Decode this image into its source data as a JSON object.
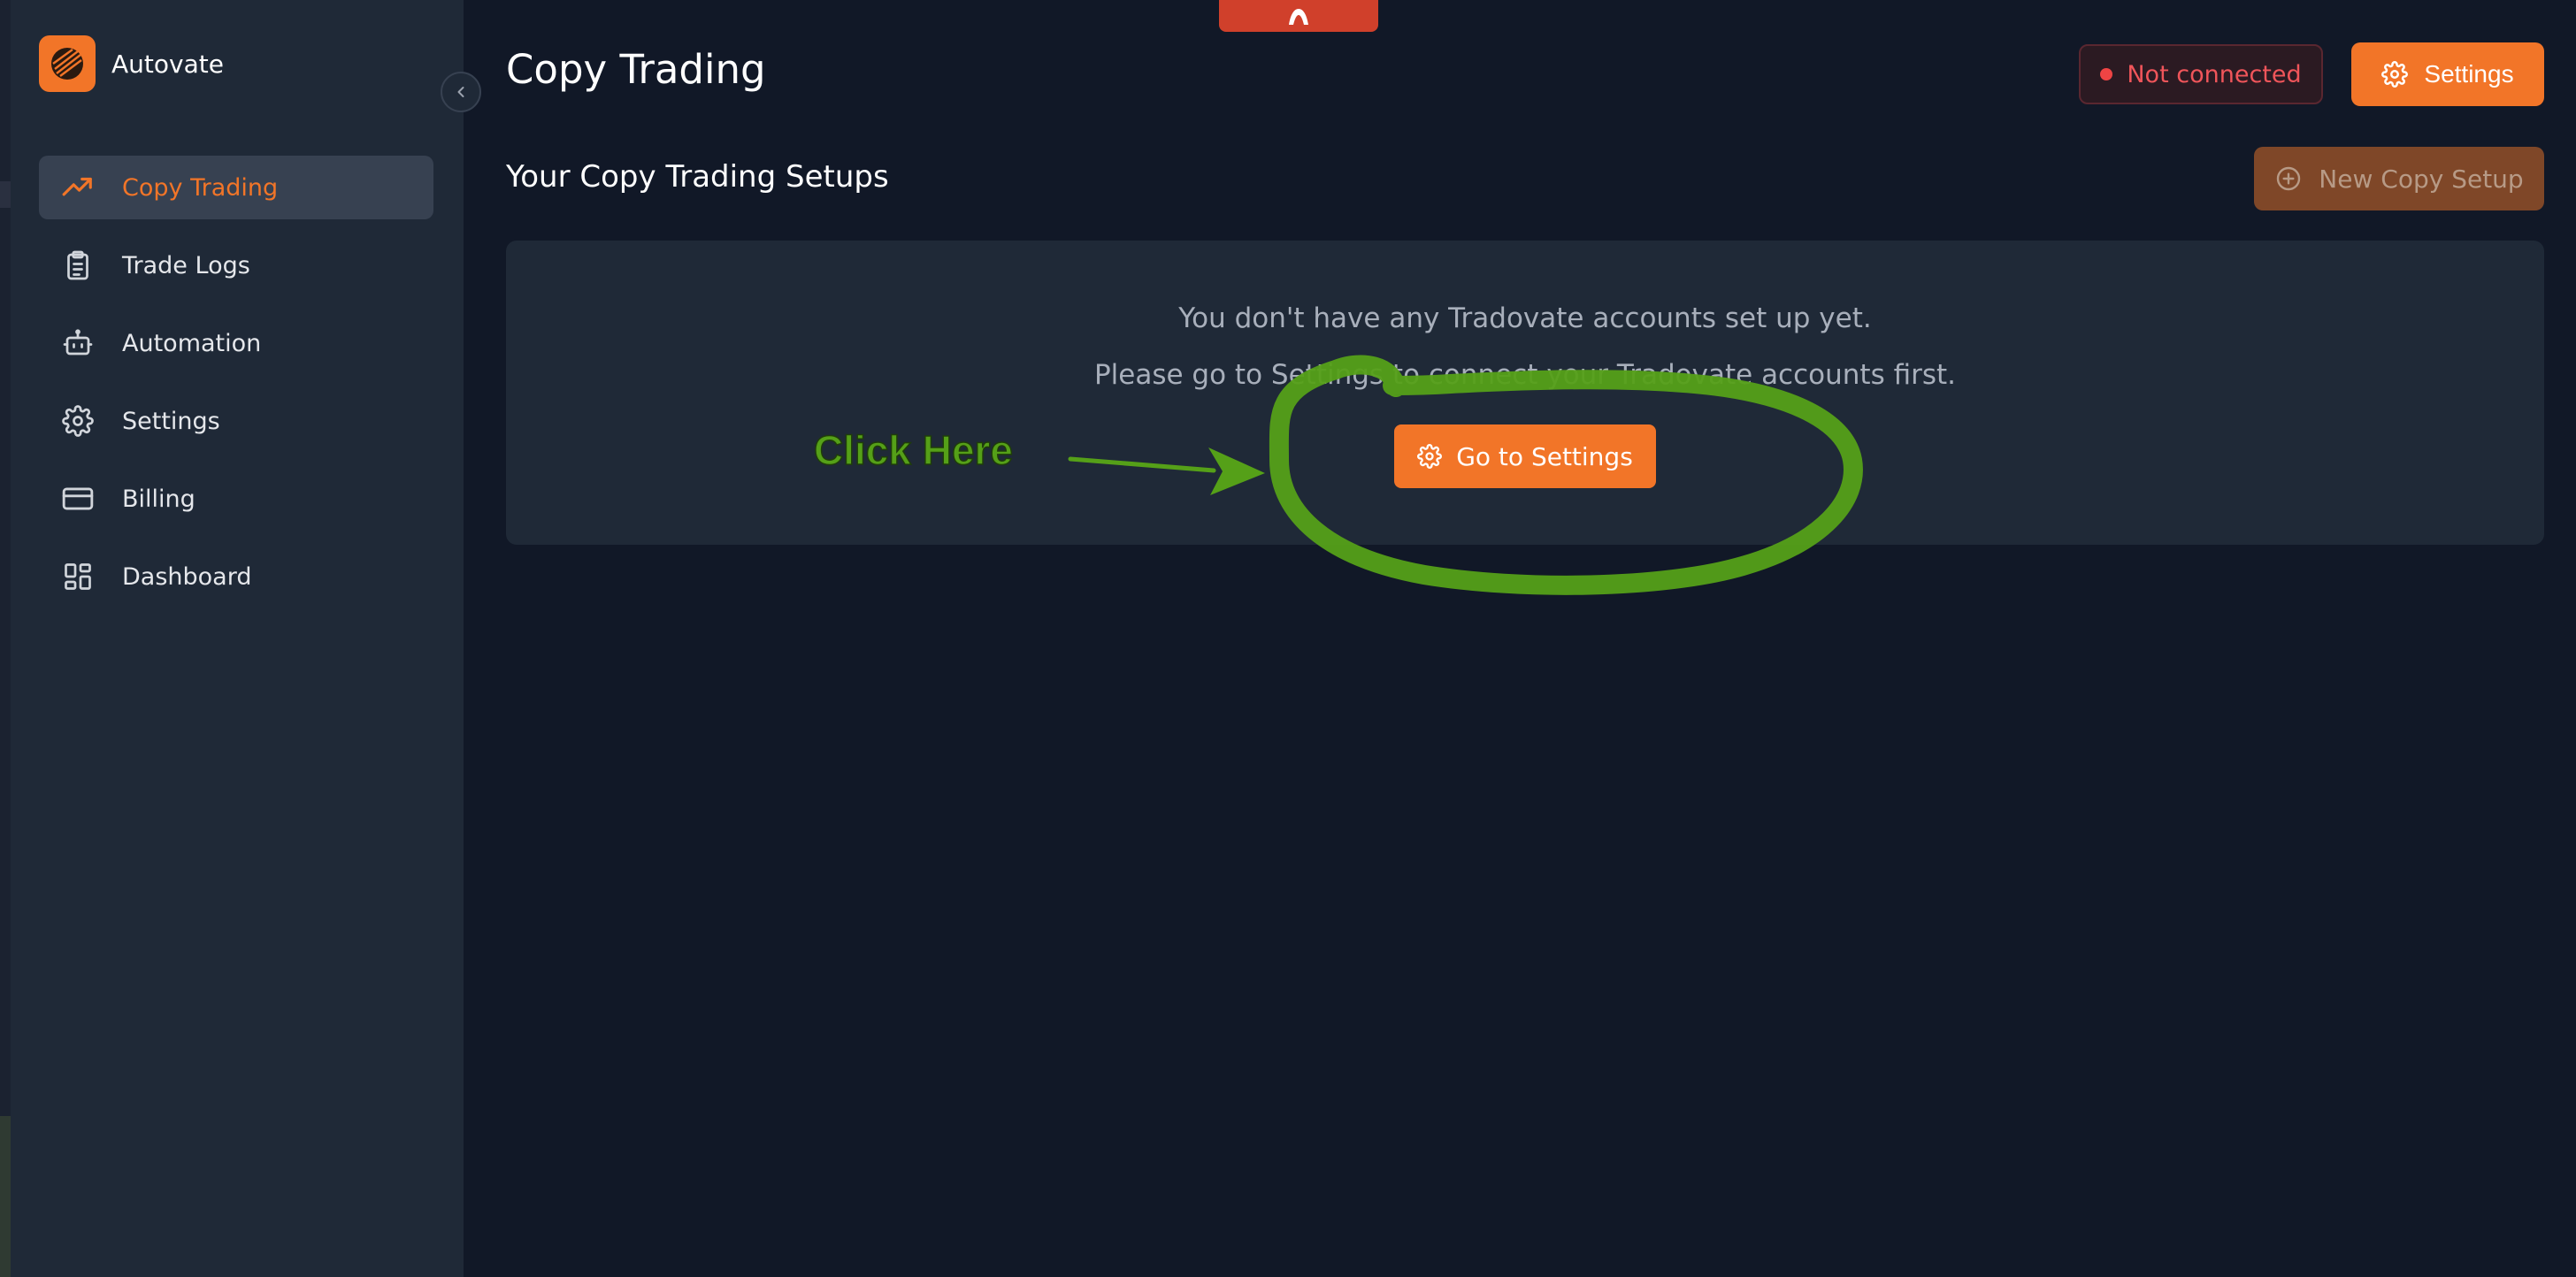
{
  "app": {
    "name": "Autovate",
    "accent_color": "#f27528"
  },
  "sidebar": {
    "items": [
      {
        "label": "Copy Trading",
        "icon": "trending-up-icon",
        "active": true
      },
      {
        "label": "Trade Logs",
        "icon": "clipboard-icon",
        "active": false
      },
      {
        "label": "Automation",
        "icon": "robot-icon",
        "active": false
      },
      {
        "label": "Settings",
        "icon": "gear-icon",
        "active": false
      },
      {
        "label": "Billing",
        "icon": "credit-card-icon",
        "active": false
      },
      {
        "label": "Dashboard",
        "icon": "dashboard-icon",
        "active": false
      }
    ]
  },
  "header": {
    "title": "Copy Trading",
    "status": "Not connected",
    "status_color": "#ef4444",
    "settings_label": "Settings"
  },
  "section": {
    "title": "Your Copy Trading Setups",
    "new_setup_label": "New Copy Setup"
  },
  "empty_state": {
    "line1": "You don't have any Tradovate accounts set up yet.",
    "line2": "Please go to Settings to connect your Tradovate accounts first.",
    "button_label": "Go to Settings"
  },
  "annotation": {
    "text": "Click Here",
    "color": "#55a018"
  }
}
